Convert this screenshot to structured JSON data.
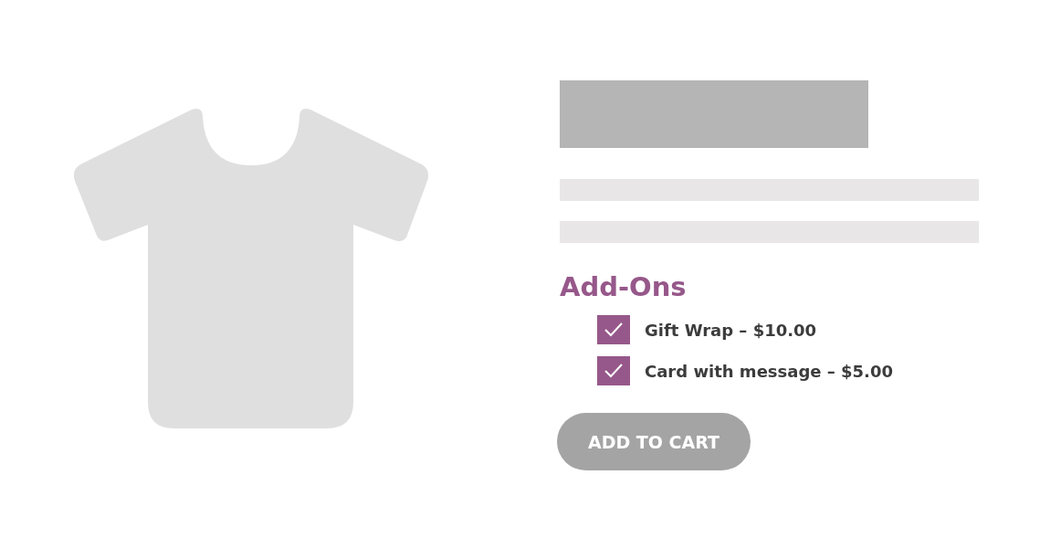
{
  "addons": {
    "title": "Add-Ons",
    "items": [
      {
        "label": "Gift Wrap – $10.00",
        "checked": true
      },
      {
        "label": "Card with message – $5.00",
        "checked": true
      }
    ]
  },
  "button": {
    "label": "ADD TO CART"
  }
}
